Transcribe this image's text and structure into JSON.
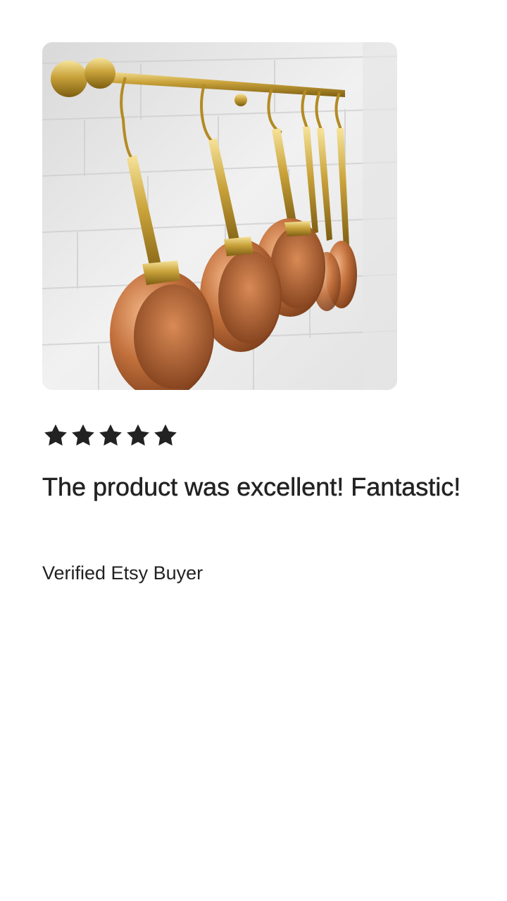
{
  "review": {
    "rating": 5,
    "rating_max": 5,
    "text": "The product was excellent! Fantastic!",
    "reviewer": "Verified Etsy Buyer"
  },
  "colors": {
    "text": "#222222",
    "background": "#ffffff",
    "star": "#222222"
  },
  "icons": {
    "star": "star-icon"
  }
}
